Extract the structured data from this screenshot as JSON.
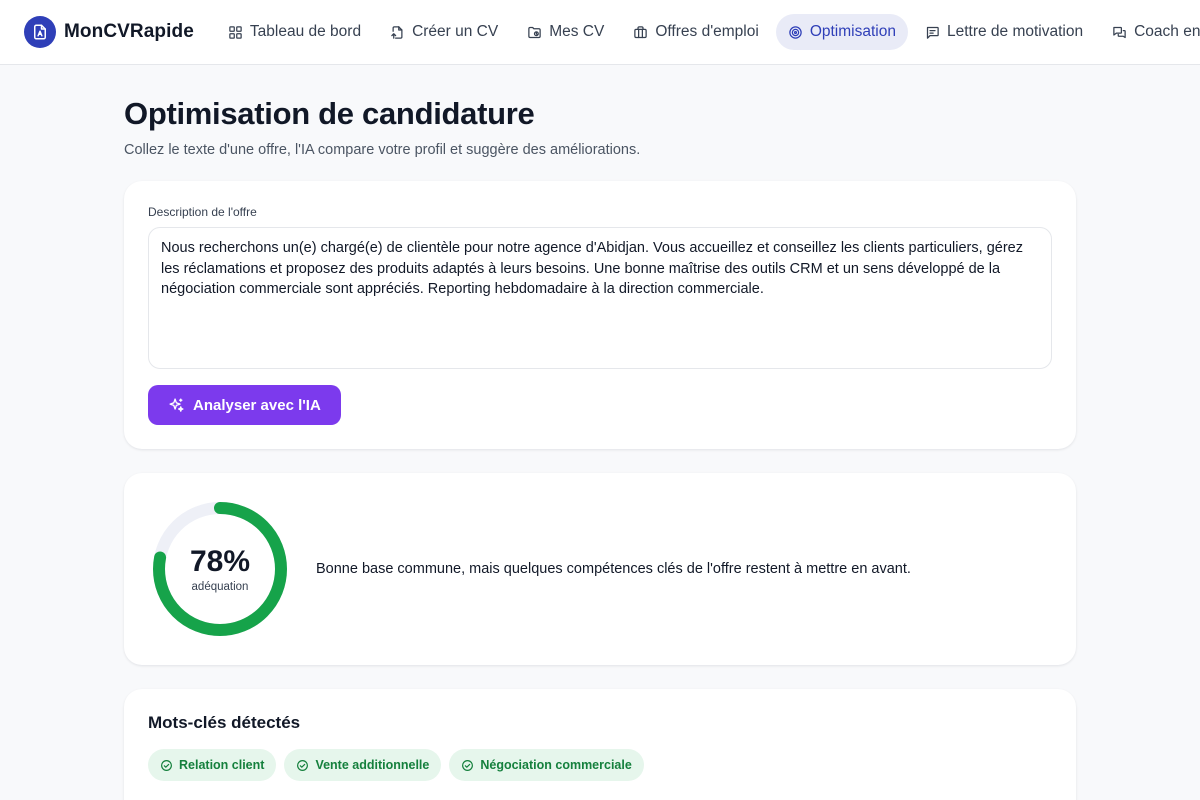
{
  "brand": {
    "name": "MonCVRapide"
  },
  "nav": {
    "items": [
      {
        "label": "Tableau de bord",
        "icon": "dashboard-icon"
      },
      {
        "label": "Créer un CV",
        "icon": "file-plus-icon"
      },
      {
        "label": "Mes CV",
        "icon": "folder-icon"
      },
      {
        "label": "Offres d'emploi",
        "icon": "briefcase-icon"
      },
      {
        "label": "Optimisation",
        "icon": "target-icon",
        "active": true
      },
      {
        "label": "Lettre de motivation",
        "icon": "message-icon"
      },
      {
        "label": "Coach entretie",
        "icon": "chat-icon"
      }
    ]
  },
  "page": {
    "title": "Optimisation de candidature",
    "subtitle": "Collez le texte d'une offre, l'IA compare votre profil et suggère des améliorations."
  },
  "offer": {
    "label": "Description de l'offre",
    "text": "Nous recherchons un(e) chargé(e) de clientèle pour notre agence d'Abidjan. Vous accueillez et conseillez les clients particuliers, gérez les réclamations et proposez des produits adaptés à leurs besoins. Une bonne maîtrise des outils CRM et un sens développé de la négociation commerciale sont appréciés. Reporting hebdomadaire à la direction commerciale.",
    "button_label": "Analyser avec l'IA"
  },
  "score": {
    "value": 78,
    "value_text": "78%",
    "caption": "adéquation",
    "summary": "Bonne base commune, mais quelques compétences clés de l'offre restent à mettre en avant."
  },
  "keywords": {
    "title": "Mots-clés détectés",
    "items": [
      "Relation client",
      "Vente additionnelle",
      "Négociation commerciale"
    ]
  },
  "colors": {
    "brand": "#2f3fb8",
    "accent": "#7c3aed",
    "success": "#16a34a",
    "chip_bg": "#e6f6ec"
  }
}
